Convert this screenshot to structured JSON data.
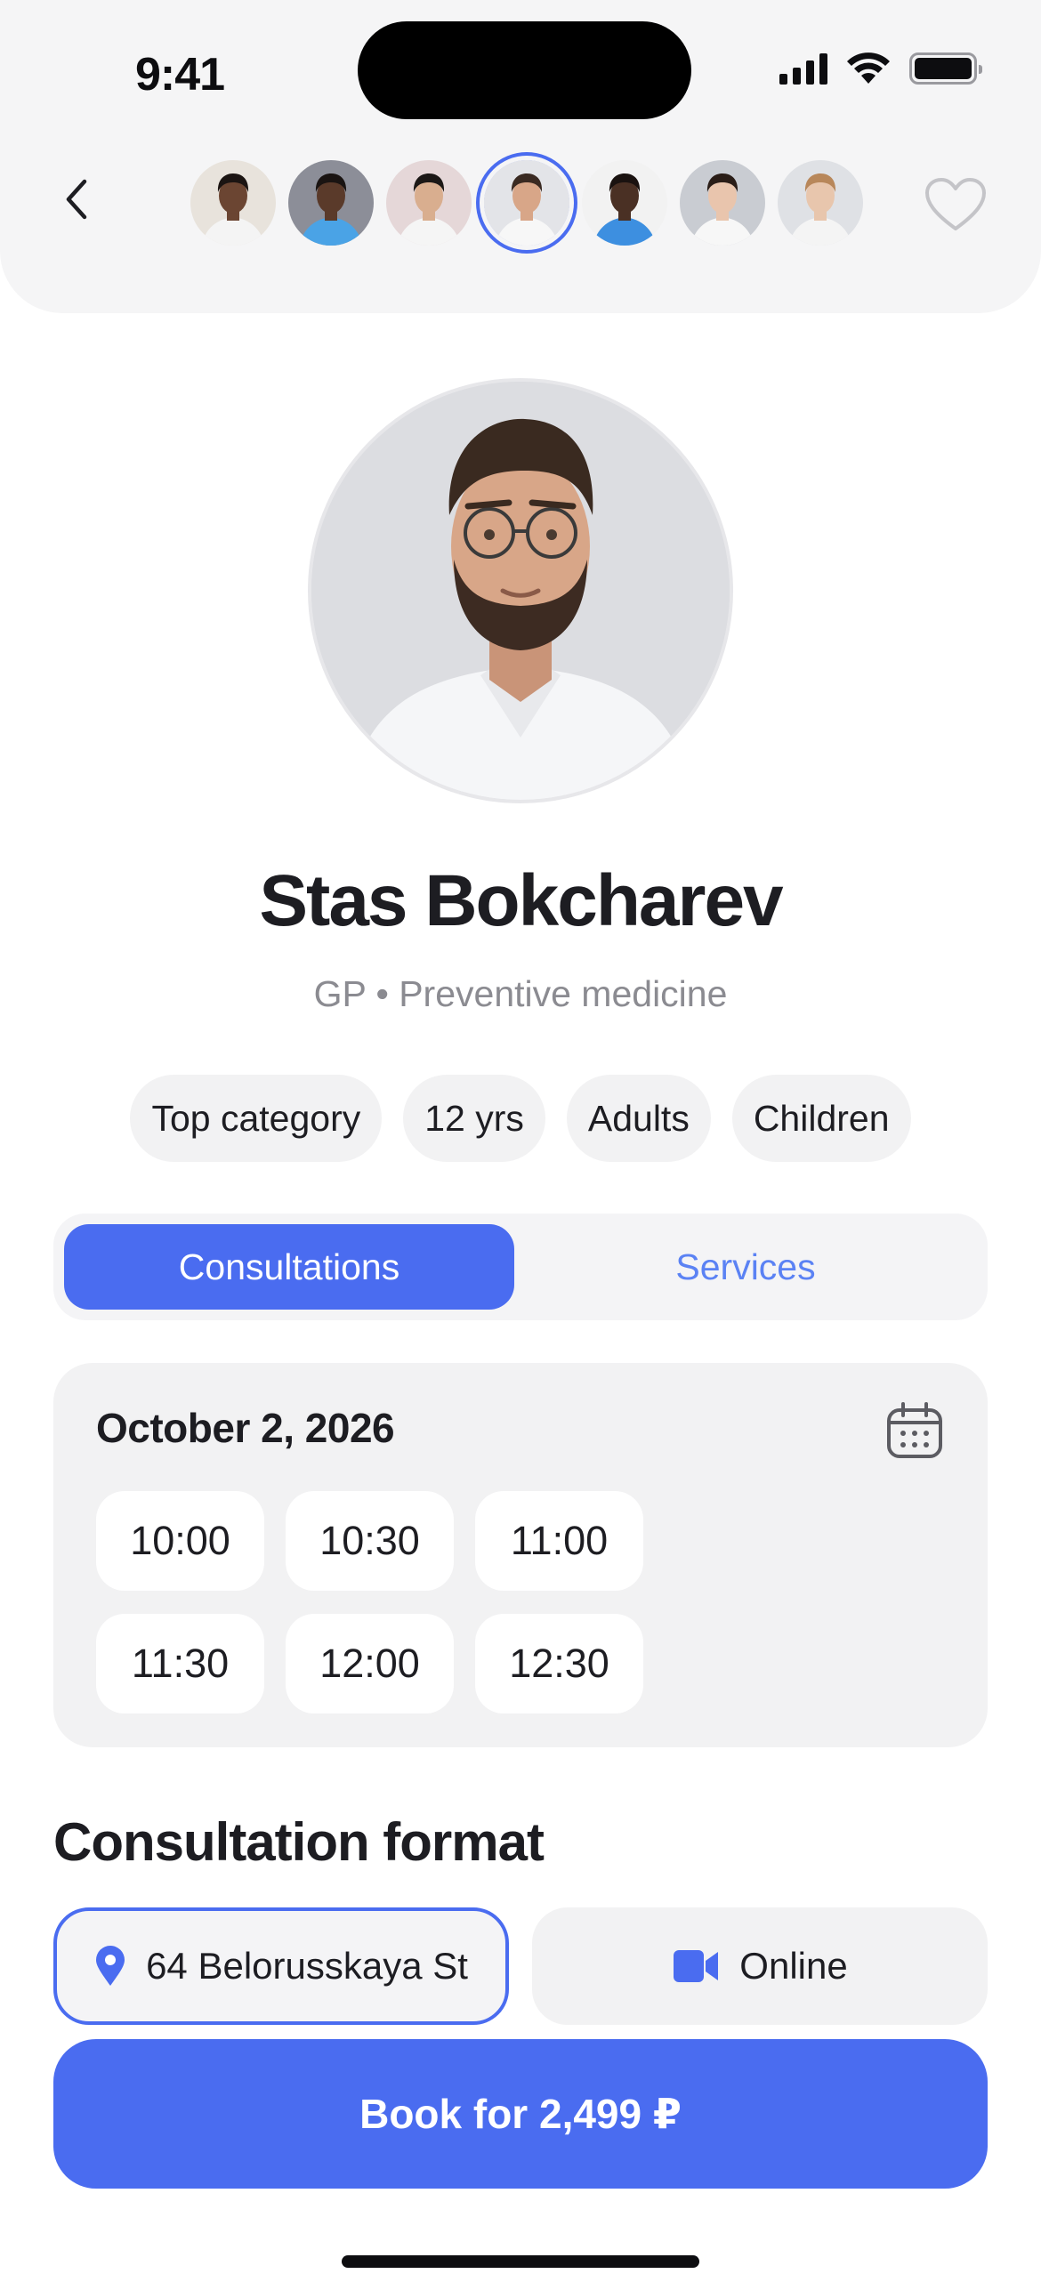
{
  "status_bar": {
    "time": "9:41"
  },
  "header": {
    "avatars": [
      {
        "name": "doctor-1",
        "bg": "#e8e3dc",
        "skin": "#6b4532",
        "hair": "#1b1412",
        "coat": "#f4f4f4"
      },
      {
        "name": "doctor-2",
        "bg": "#8c8e98",
        "skin": "#5a3a2a",
        "hair": "#1a1412",
        "coat": "#4aa3e6"
      },
      {
        "name": "doctor-3",
        "bg": "#e5d7d8",
        "skin": "#d9ae8f",
        "hair": "#1c1816",
        "coat": "#f5f5f5"
      },
      {
        "name": "doctor-4",
        "bg": "#e3e4e8",
        "skin": "#d8a688",
        "hair": "#3a2a22",
        "coat": "#f7f7f7",
        "selected": true
      },
      {
        "name": "doctor-5",
        "bg": "#f2f2f2",
        "skin": "#4a3024",
        "hair": "#1a1210",
        "coat": "#3d8fe0"
      },
      {
        "name": "doctor-6",
        "bg": "#c9ccd2",
        "skin": "#e9c5ad",
        "hair": "#2a1d17",
        "coat": "#f7f7f7"
      },
      {
        "name": "doctor-7",
        "bg": "#dfe1e5",
        "skin": "#e8c6ad",
        "hair": "#b8875a",
        "coat": "#f4f4f4"
      }
    ]
  },
  "profile": {
    "name": "Stas Bokcharev",
    "specialty": "GP • Preventive medicine",
    "chips": [
      "Top category",
      "12 yrs",
      "Adults",
      "Children"
    ]
  },
  "tabs": {
    "active": "Consultations",
    "inactive": "Services"
  },
  "schedule": {
    "date": "October 2, 2026",
    "slots": [
      "10:00",
      "10:30",
      "11:00",
      "11:30",
      "12:00",
      "12:30"
    ]
  },
  "format": {
    "title": "Consultation format",
    "address": "64 Belorusskaya St",
    "online": "Online"
  },
  "book_button": "Book for 2,499 ₽",
  "colors": {
    "accent": "#4a6cf0",
    "tab_inactive": "#5b82f4",
    "chip_bg": "#f2f2f3"
  }
}
